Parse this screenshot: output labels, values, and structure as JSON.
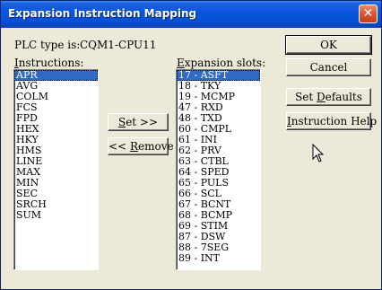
{
  "window": {
    "title": "Expansion Instruction Mapping",
    "close_glyph": "✕"
  },
  "plc": {
    "label": "PLC type is:",
    "value": "CQM1-CPU11"
  },
  "instructions": {
    "label_prefix": "",
    "label_hotkey": "I",
    "label_rest": "nstructions:",
    "items": [
      "APR",
      "AVG",
      "COLM",
      "FCS",
      "FPD",
      "HEX",
      "HKY",
      "HMS",
      "LINE",
      "MAX",
      "MIN",
      "SEC",
      "SRCH",
      "SUM"
    ],
    "selected_index": 0
  },
  "expansion": {
    "label_prefix": "",
    "label_hotkey": "E",
    "label_rest": "xpansion slots:",
    "items": [
      "17 - ASFT",
      "18 - TKY",
      "19 - MCMP",
      "47 - RXD",
      "48 - TXD",
      "60 - CMPL",
      "61 - INI",
      "62 - PRV",
      "63 - CTBL",
      "64 - SPED",
      "65 - PULS",
      "66 - SCL",
      "67 - BCNT",
      "68 - BCMP",
      "69 - STIM",
      "87 - DSW",
      "88 - 7SEG",
      "89 - INT"
    ],
    "selected_index": 0
  },
  "buttons": {
    "set": {
      "prefix": "",
      "hotkey": "S",
      "rest": "et  >>"
    },
    "remove": {
      "prefix": "<<  ",
      "hotkey": "R",
      "rest": "emove"
    },
    "ok": {
      "label": "OK"
    },
    "cancel": {
      "label": "Cancel"
    },
    "set_defaults": {
      "prefix": "Set ",
      "hotkey": "D",
      "rest": "efaults"
    },
    "instruction_help": {
      "prefix": "",
      "hotkey": "I",
      "rest": "nstruction Help"
    }
  },
  "icons": {
    "close": "close-icon",
    "cursor": "mouse-pointer-icon"
  }
}
